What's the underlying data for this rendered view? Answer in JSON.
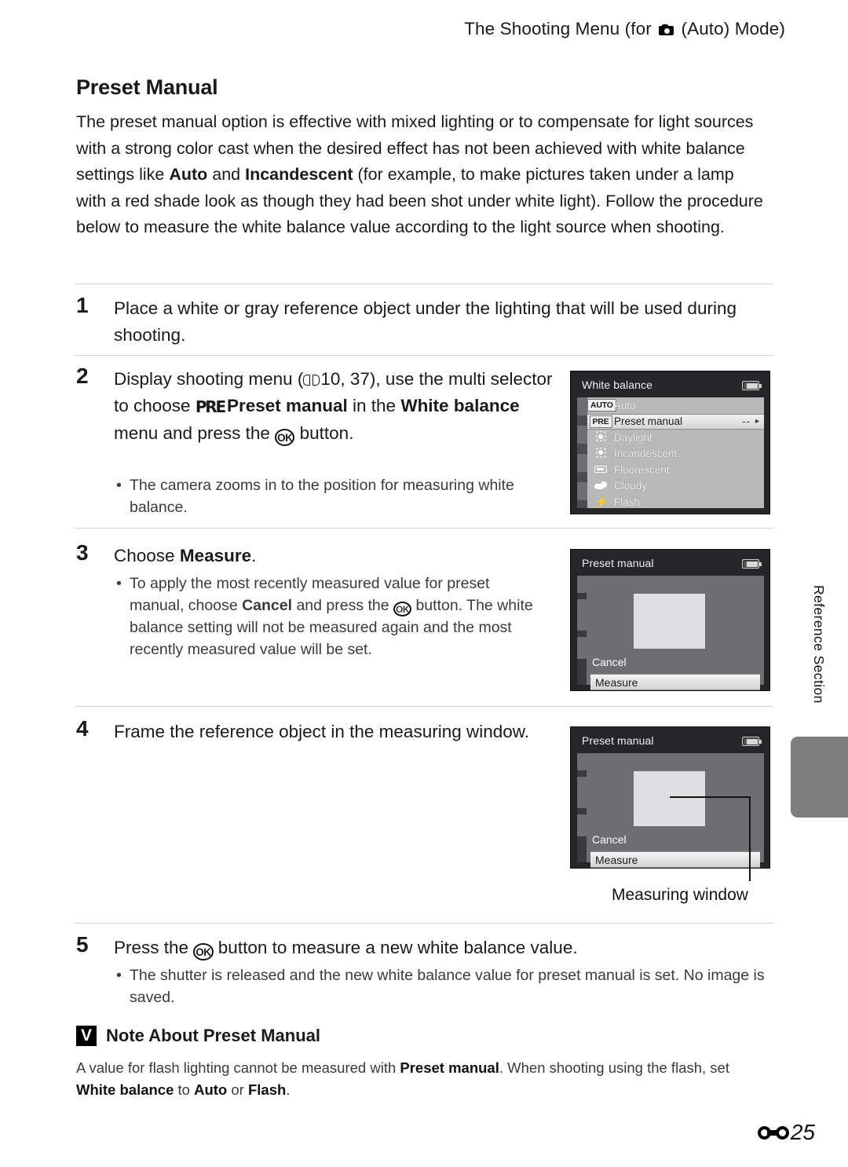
{
  "header": {
    "prefix": "The Shooting Menu (for ",
    "camera_icon": "camera-icon",
    "suffix": " (Auto) Mode)"
  },
  "section": {
    "title": "Preset Manual",
    "intro_1": "The preset manual option is effective with mixed lighting or to compensate for light sources with a strong color cast when the desired effect has not been achieved with white balance settings like ",
    "intro_b1": "Auto",
    "intro_2": " and ",
    "intro_b2": "Incandescent",
    "intro_3": " (for example, to make pictures taken under a lamp with a red shade look as though they had been shot under white light). Follow the procedure below to measure the white balance value according to the light source when shooting."
  },
  "steps": {
    "one": {
      "number": "1",
      "text": "Place a white or gray reference object under the lighting that will be used during shooting."
    },
    "two": {
      "number": "2",
      "t1": "Display shooting menu (",
      "book_icon": "book-icon",
      "t2": "10, 37), use the multi selector to choose ",
      "pre_glyph": "PRE",
      "b1": "Preset manual",
      "t3": " in the ",
      "b2": "White balance",
      "t4": " menu and press the ",
      "ok_glyph": "OK",
      "t5": " button.",
      "bullet": "The camera zooms in to the position for measuring white balance."
    },
    "three": {
      "number": "3",
      "t1": "Choose ",
      "b1": "Measure",
      "t2": ".",
      "bullet_1": "To apply the most recently measured value for preset manual, choose ",
      "bullet_b1": "Cancel",
      "bullet_2": " and press the ",
      "bullet_ok": "OK",
      "bullet_3": " button. The white balance setting will not be measured again and the most recently measured value will be set."
    },
    "four": {
      "number": "4",
      "text": "Frame the reference object in the measuring window."
    },
    "five": {
      "number": "5",
      "t1": "Press the ",
      "ok_glyph": "OK",
      "t2": " button to measure a new white balance value.",
      "bullet": "The shutter is released and the new white balance value for preset manual is set. No image is saved."
    }
  },
  "screens": {
    "white_balance": {
      "title": "White balance",
      "battery_icon": "battery-icon",
      "rows": [
        {
          "tag": "AUTO",
          "icon": "auto-tag",
          "label": "Auto",
          "value": "",
          "arrow": "",
          "selected": false
        },
        {
          "tag": "PRE",
          "icon": "pre-tag",
          "label": "Preset manual",
          "value": "--",
          "arrow": "▸",
          "selected": true
        },
        {
          "tag": "",
          "icon": "sun-icon",
          "label": "Daylight",
          "value": "",
          "arrow": "",
          "selected": false
        },
        {
          "tag": "",
          "icon": "bulb-icon",
          "label": "Incandescent",
          "value": "",
          "arrow": "",
          "selected": false
        },
        {
          "tag": "",
          "icon": "fluorescent-tube-icon",
          "label": "Fluorescent",
          "value": "",
          "arrow": "",
          "selected": false
        },
        {
          "tag": "",
          "icon": "cloud-icon",
          "label": "Cloudy",
          "value": "",
          "arrow": "",
          "selected": false
        },
        {
          "tag": "",
          "icon": "flash-bolt-icon",
          "label": "Flash",
          "value": "",
          "arrow": "",
          "selected": false
        }
      ]
    },
    "preset_manual_a": {
      "title": "Preset manual",
      "battery_icon": "battery-icon",
      "cancel": "Cancel",
      "measure": "Measure"
    },
    "preset_manual_b": {
      "title": "Preset manual",
      "battery_icon": "battery-icon",
      "cancel": "Cancel",
      "measure": "Measure",
      "callout_label": "Measuring window"
    }
  },
  "side_tab": {
    "label": "Reference Section"
  },
  "note": {
    "title": "Note About Preset Manual",
    "t1": "A value for flash lighting cannot be measured with ",
    "b1": "Preset manual",
    "t2": ". When shooting using the flash, set ",
    "b2": "White balance",
    "t3": " to ",
    "b3": "Auto",
    "t4": " or ",
    "b4": "Flash",
    "t5": "."
  },
  "footer": {
    "icon": "reference-symbol-icon",
    "page": "25"
  },
  "colors": {
    "lcd_bg": "#26262a",
    "lcd_list": "#b9b9b9",
    "lcd_frame": "#6e6e72",
    "rule": "#d2d2d2",
    "side_tab": "#7d7d7d"
  }
}
